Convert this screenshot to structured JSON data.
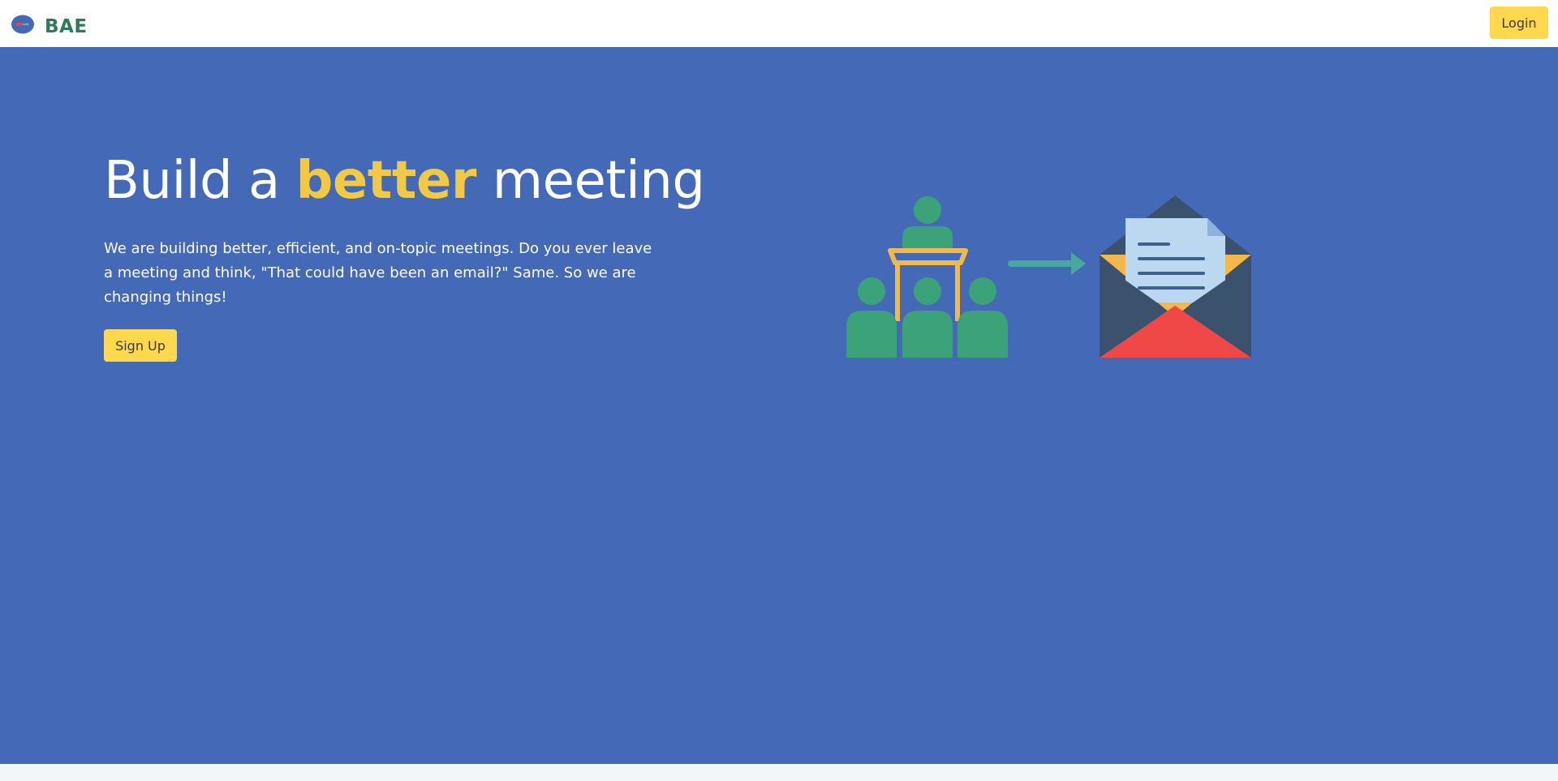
{
  "navbar": {
    "brand_name": "BAE",
    "logo_icon": "meeting-logo-icon",
    "login_label": "Login"
  },
  "hero": {
    "title_before": "Build a ",
    "title_accent": "better",
    "title_after": " meeting",
    "description": "We are building better, efficient, and on-topic meetings. Do you ever leave a meeting and think, \"That could have been an email?\" Same. So we are changing things!",
    "signup_label": "Sign Up",
    "illustration_icons": [
      "presenter-icon",
      "audience-icon",
      "arrow-right-icon",
      "envelope-icon"
    ]
  },
  "colors": {
    "hero_background": "#4469b6",
    "accent_yellow": "#f1c944",
    "button_yellow": "#ffd84d",
    "brand_green": "#2f7a5b",
    "footer_background": "#f3f6f8"
  }
}
